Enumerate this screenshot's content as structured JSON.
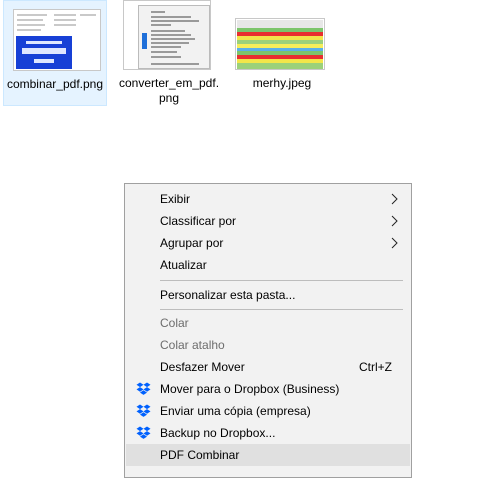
{
  "files": [
    {
      "name": "combinar_pdf.png"
    },
    {
      "name": "converter_em_pdf.png"
    },
    {
      "name": "merhy.jpeg"
    }
  ],
  "context_menu": {
    "view": "Exibir",
    "sort_by": "Classificar por",
    "group_by": "Agrupar por",
    "refresh": "Atualizar",
    "customize": "Personalizar esta pasta...",
    "paste": "Colar",
    "paste_shortcut": "Colar atalho",
    "undo_move": "Desfazer Mover",
    "undo_move_shortcut": "Ctrl+Z",
    "move_dropbox_business": "Mover para o Dropbox (Business)",
    "send_copy_company": "Enviar uma cópia (empresa)",
    "backup_dropbox": "Backup no Dropbox...",
    "pdf_combine": "PDF Combinar"
  },
  "colors": {
    "selection_bg": "#e5f3ff",
    "menu_bg": "#f2f2f2",
    "dropbox_blue": "#0061fe",
    "disabled_text": "#6d6d6d"
  }
}
